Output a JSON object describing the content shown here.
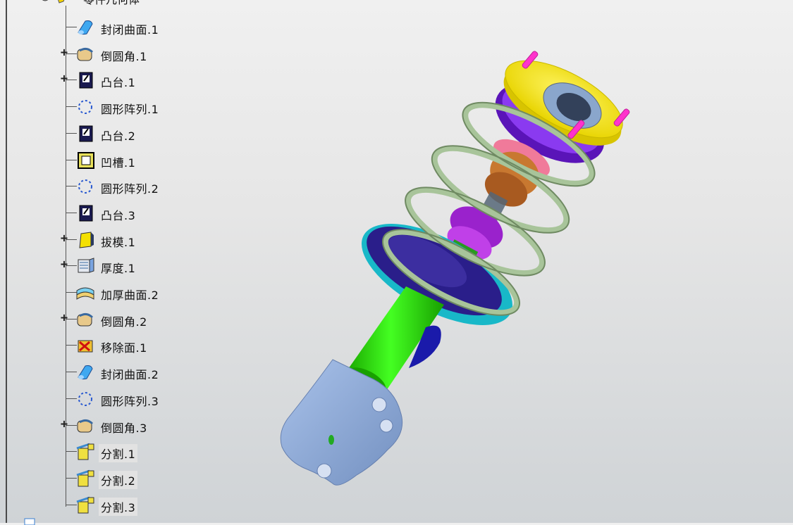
{
  "tree": {
    "top_label": "零件几何体",
    "items": [
      {
        "label": "封闭曲面.1",
        "icon": "close-surface-icon",
        "expandable": false,
        "highlight": false
      },
      {
        "label": "倒圆角.1",
        "icon": "edge-fillet-icon",
        "expandable": true,
        "highlight": false
      },
      {
        "label": "凸台.1",
        "icon": "pad-icon",
        "expandable": true,
        "highlight": false
      },
      {
        "label": "圆形阵列.1",
        "icon": "circular-pattern-icon",
        "expandable": false,
        "highlight": false
      },
      {
        "label": "凸台.2",
        "icon": "pad-icon",
        "expandable": false,
        "highlight": false
      },
      {
        "label": "凹槽.1",
        "icon": "pocket-icon",
        "expandable": false,
        "highlight": false
      },
      {
        "label": "圆形阵列.2",
        "icon": "circular-pattern-icon",
        "expandable": false,
        "highlight": false
      },
      {
        "label": "凸台.3",
        "icon": "pad-icon",
        "expandable": false,
        "highlight": false
      },
      {
        "label": "拔模.1",
        "icon": "draft-icon",
        "expandable": true,
        "highlight": false
      },
      {
        "label": "厚度.1",
        "icon": "thickness-icon",
        "expandable": true,
        "highlight": false
      },
      {
        "label": "加厚曲面.2",
        "icon": "thick-surface-icon",
        "expandable": false,
        "highlight": false
      },
      {
        "label": "倒圆角.2",
        "icon": "edge-fillet-icon",
        "expandable": true,
        "highlight": false
      },
      {
        "label": "移除面.1",
        "icon": "remove-face-icon",
        "expandable": false,
        "highlight": false
      },
      {
        "label": "封闭曲面.2",
        "icon": "close-surface-icon",
        "expandable": false,
        "highlight": false
      },
      {
        "label": "圆形阵列.3",
        "icon": "circular-pattern-icon",
        "expandable": false,
        "highlight": false
      },
      {
        "label": "倒圆角.3",
        "icon": "edge-fillet-icon",
        "expandable": true,
        "highlight": false
      },
      {
        "label": "分割.1",
        "icon": "split-icon",
        "expandable": false,
        "highlight": true
      },
      {
        "label": "分割.2",
        "icon": "split-icon",
        "expandable": false,
        "highlight": true
      },
      {
        "label": "分割.3",
        "icon": "split-icon",
        "expandable": false,
        "highlight": true
      }
    ]
  },
  "model": {
    "name": "strut-assembly",
    "colors": {
      "tube": "#22dd00",
      "knuckle": "#8eaad8",
      "spring": "#a8c49a",
      "top_plate": "#ffee00",
      "upper_seat": "#7a1ee0",
      "lower_seat": "#20c8d8",
      "studs": "#ff33cc",
      "bumper": "#9a22cc",
      "bearing": "#c87830",
      "rod": "#556677"
    }
  }
}
